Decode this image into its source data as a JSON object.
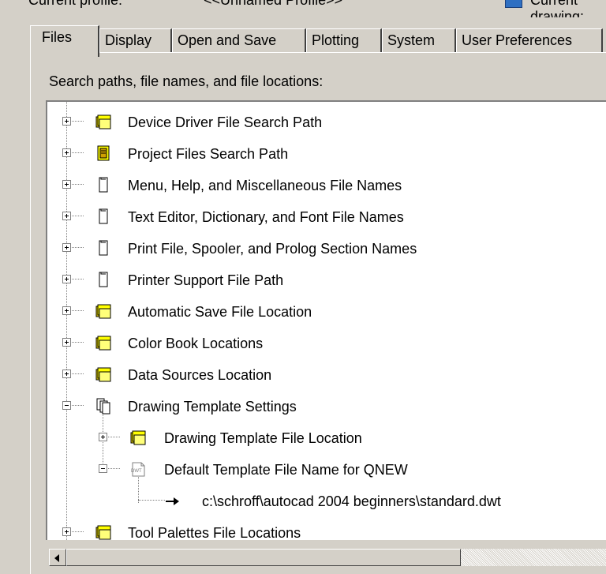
{
  "profile": {
    "label": "Current profile:",
    "name": "<<Unnamed Profile>>",
    "right_label": "Current drawing:"
  },
  "tabs": [
    {
      "label": "Files",
      "active": true
    },
    {
      "label": "Display"
    },
    {
      "label": "Open and Save"
    },
    {
      "label": "Plotting"
    },
    {
      "label": "System"
    },
    {
      "label": "User Preferences"
    }
  ],
  "caption": "Search paths, file names, and file locations:",
  "tree": {
    "items": [
      {
        "label": "Device Driver File Search Path",
        "icon": "folder-stack-icon",
        "expanded": false
      },
      {
        "label": "Project Files Search Path",
        "icon": "project-folder-icon",
        "expanded": false
      },
      {
        "label": "Menu, Help, and Miscellaneous File Names",
        "icon": "document-icon",
        "expanded": false
      },
      {
        "label": "Text Editor, Dictionary, and Font File Names",
        "icon": "document-icon",
        "expanded": false
      },
      {
        "label": "Print File, Spooler, and Prolog Section Names",
        "icon": "document-icon",
        "expanded": false
      },
      {
        "label": "Printer Support File Path",
        "icon": "document-icon",
        "expanded": false
      },
      {
        "label": "Automatic Save File Location",
        "icon": "folder-stack-icon",
        "expanded": false
      },
      {
        "label": "Color Book Locations",
        "icon": "folder-stack-icon",
        "expanded": false
      },
      {
        "label": "Data Sources Location",
        "icon": "folder-stack-icon",
        "expanded": false
      },
      {
        "label": "Drawing Template Settings",
        "icon": "documents-stack-icon",
        "expanded": true
      },
      {
        "label": "Drawing Template File Location",
        "icon": "folder-stack-icon",
        "expanded": false
      },
      {
        "label": "Default Template File Name for QNEW",
        "icon": "dwt-file-icon",
        "expanded": true
      },
      {
        "label": "c:\\schroff\\autocad 2004 beginners\\standard.dwt",
        "icon": "arrow-right-icon"
      },
      {
        "label": "Tool Palettes File Locations",
        "icon": "folder-stack-icon",
        "expanded": false
      }
    ],
    "dwt_badge": "DWT"
  }
}
